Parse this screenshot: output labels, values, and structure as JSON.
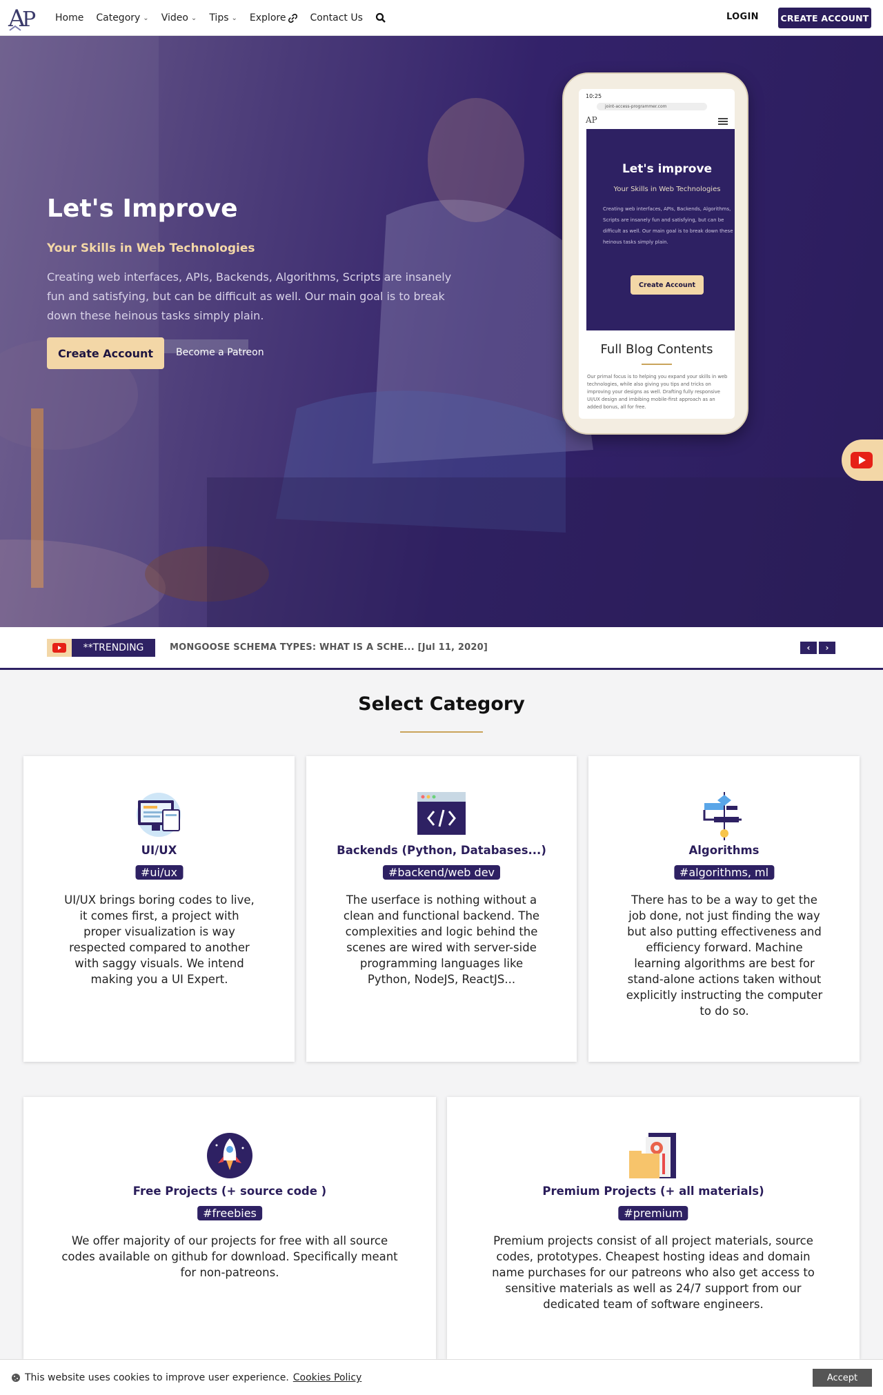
{
  "nav": {
    "logo_text": "AP",
    "links": [
      {
        "label": "Home",
        "has_caret": false
      },
      {
        "label": "Category",
        "has_caret": true
      },
      {
        "label": "Video",
        "has_caret": true
      },
      {
        "label": "Tips",
        "has_caret": true
      },
      {
        "label": "Explore",
        "icon": "link-icon"
      },
      {
        "label": "Contact Us"
      }
    ],
    "search_icon": "search-icon",
    "login_label": "LOGIN",
    "create_account_label": "CREATE ACCOUNT"
  },
  "hero": {
    "title": "Let's Improve",
    "subtitle": "Your Skills in Web Technologies",
    "description": "Creating web interfaces, APIs, Backends, Algorithms, Scripts are insanely fun and satisfying, but can be difficult as well. Our main goal is to break down these heinous tasks simply plain.",
    "cta_label": "Create Account",
    "secondary_link": "Become a Patreon",
    "colors": {
      "primary": "#2b1d5c",
      "accent": "#f3d7a7"
    }
  },
  "phone": {
    "status_time": "10:25",
    "url": "joint-access-programmer.com",
    "logo": "AP",
    "title": "Let's improve",
    "subtitle": "Your Skills in Web Technologies",
    "description": "Creating web interfaces, APIs, Backends, Algorithms, Scripts are insanely fun and satisfying, but can be difficult as well. Our main goal is to break down these heinous tasks simply plain.",
    "cta_label": "Create Account",
    "blog_title": "Full Blog Contents",
    "blog_desc": "Our primal focus is to helping you expand your skills in web technologies, while also giving you tips and tricks on improving your designs as well. Drafting fully responsive UI/UX design and imbibing mobile-first approach as an added bonus, all for free."
  },
  "youtube_icon": "youtube-icon",
  "trending": {
    "tag": "**TRENDING",
    "headline": "MONGOOSE SCHEMA TYPES: WHAT IS A SCHE... [Jul 11, 2020]",
    "prev_icon": "chevron-left-icon",
    "next_icon": "chevron-right-icon"
  },
  "categories": {
    "title": "Select Category",
    "items": [
      {
        "title": "UI/UX",
        "tag": "#ui/ux",
        "icon": "monitor-icon",
        "description": "UI/UX brings boring codes to live, it comes first, a project with proper visualization is way respected compared to another with saggy visuals. We intend making you a UI Expert."
      },
      {
        "title": "Backends (Python, Databases...)",
        "tag": "#backend/web dev",
        "icon": "code-window-icon",
        "description": "The userface is nothing without a clean and functional backend. The complexities and logic behind the scenes are wired with server-side programming languages like Python, NodeJS, ReactJS..."
      },
      {
        "title": "Algorithms",
        "tag": "#algorithms, ml",
        "icon": "flowchart-icon",
        "description": "There has to be a way to get the job done, not just finding the way but also putting effectiveness and efficiency forward. Machine learning algorithms are best for stand-alone actions taken without explicitly instructing the computer to do so."
      },
      {
        "title": "Free Projects (+ source code )",
        "tag": "#freebies",
        "icon": "rocket-icon",
        "description": "We offer majority of our projects for free with all source codes available on github for download. Specifically meant for non-patreons."
      },
      {
        "title": "Premium Projects (+ all materials)",
        "tag": "#premium",
        "icon": "folder-gear-icon",
        "description": "Premium projects consist of all project materials, source codes, prototypes. Cheapest hosting ideas and domain name purchases for our patreons who also get access to sensitive materials as well as 24/7 support from our dedicated team of software engineers."
      }
    ]
  },
  "cookie": {
    "text": "This website uses cookies to improve user experience.",
    "link": "Cookies Policy",
    "accept_label": "Accept"
  }
}
